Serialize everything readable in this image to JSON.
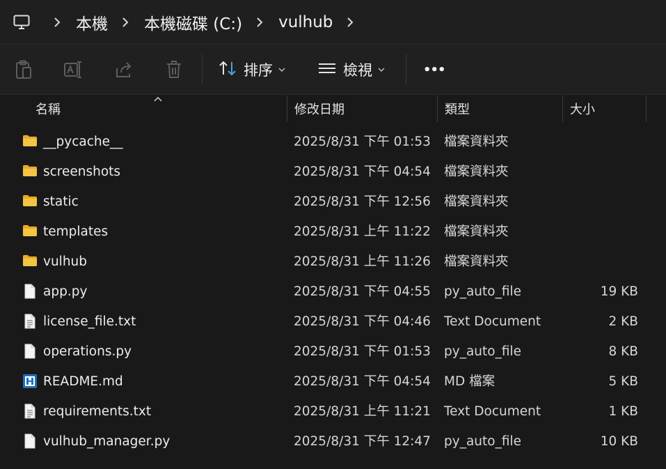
{
  "breadcrumb": {
    "items": [
      {
        "label": "本機"
      },
      {
        "label": "本機磁碟 (C:)"
      },
      {
        "label": "vulhub"
      }
    ]
  },
  "toolbar": {
    "sort_label": "排序",
    "view_label": "檢視",
    "more_label": "•••"
  },
  "columns": {
    "name": "名稱",
    "date": "修改日期",
    "type": "類型",
    "size": "大小"
  },
  "files": [
    {
      "icon": "folder-icon",
      "name": "__pycache__",
      "date": "2025/8/31 下午 01:53",
      "type": "檔案資料夾",
      "size": ""
    },
    {
      "icon": "folder-icon",
      "name": "screenshots",
      "date": "2025/8/31 下午 04:54",
      "type": "檔案資料夾",
      "size": ""
    },
    {
      "icon": "folder-icon",
      "name": "static",
      "date": "2025/8/31 下午 12:56",
      "type": "檔案資料夾",
      "size": ""
    },
    {
      "icon": "folder-icon",
      "name": "templates",
      "date": "2025/8/31 上午 11:22",
      "type": "檔案資料夾",
      "size": ""
    },
    {
      "icon": "folder-icon",
      "name": "vulhub",
      "date": "2025/8/31 上午 11:26",
      "type": "檔案資料夾",
      "size": ""
    },
    {
      "icon": "file-icon",
      "name": "app.py",
      "date": "2025/8/31 下午 04:55",
      "type": "py_auto_file",
      "size": "19 KB"
    },
    {
      "icon": "text-file-icon",
      "name": "license_file.txt",
      "date": "2025/8/31 下午 04:46",
      "type": "Text Document",
      "size": "2 KB"
    },
    {
      "icon": "file-icon",
      "name": "operations.py",
      "date": "2025/8/31 下午 01:53",
      "type": "py_auto_file",
      "size": "8 KB"
    },
    {
      "icon": "markdown-file-icon",
      "name": "README.md",
      "date": "2025/8/31 下午 04:54",
      "type": "MD 檔案",
      "size": "5 KB"
    },
    {
      "icon": "text-file-icon",
      "name": "requirements.txt",
      "date": "2025/8/31 上午 11:21",
      "type": "Text Document",
      "size": "1 KB"
    },
    {
      "icon": "file-icon",
      "name": "vulhub_manager.py",
      "date": "2025/8/31 下午 12:47",
      "type": "py_auto_file",
      "size": "10 KB"
    }
  ],
  "colors": {
    "background": "#191919",
    "folder": "#f4c542",
    "accent": "#4aa3df"
  }
}
